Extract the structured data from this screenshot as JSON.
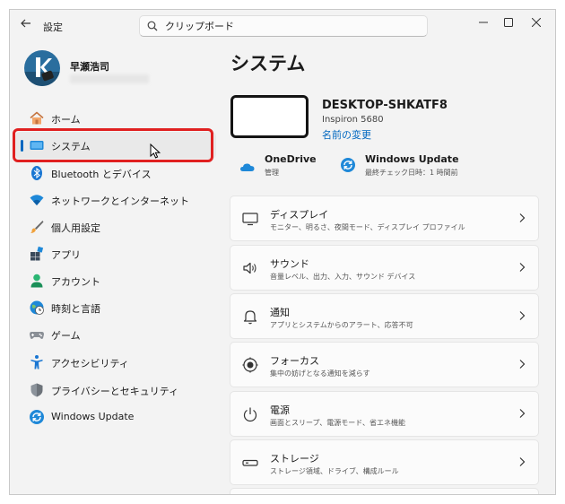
{
  "window": {
    "app_title": "設定",
    "search_value": "クリップボード"
  },
  "profile": {
    "name": "早瀬浩司"
  },
  "sidebar": {
    "items": [
      {
        "label": "ホーム",
        "icon": "home-icon"
      },
      {
        "label": "システム",
        "icon": "system-icon",
        "selected": true
      },
      {
        "label": "Bluetooth とデバイス",
        "icon": "bluetooth-icon"
      },
      {
        "label": "ネットワークとインターネット",
        "icon": "network-icon"
      },
      {
        "label": "個人用設定",
        "icon": "brush-icon"
      },
      {
        "label": "アプリ",
        "icon": "apps-icon"
      },
      {
        "label": "アカウント",
        "icon": "account-icon"
      },
      {
        "label": "時刻と言語",
        "icon": "time-language-icon"
      },
      {
        "label": "ゲーム",
        "icon": "gaming-icon"
      },
      {
        "label": "アクセシビリティ",
        "icon": "accessibility-icon"
      },
      {
        "label": "プライバシーとセキュリティ",
        "icon": "shield-icon"
      },
      {
        "label": "Windows Update",
        "icon": "windows-update-icon"
      }
    ]
  },
  "main": {
    "title": "システム",
    "device": {
      "name": "DESKTOP-SHKATF8",
      "model": "Inspiron 5680",
      "rename_link": "名前の変更"
    },
    "quick": [
      {
        "title": "OneDrive",
        "subtitle": "管理",
        "icon": "onedrive-icon"
      },
      {
        "title": "Windows Update",
        "subtitle": "最終チェック日時：1 時間前",
        "icon": "windows-update-icon"
      }
    ],
    "cards": [
      {
        "title": "ディスプレイ",
        "subtitle": "モニター、明るさ、夜間モード、ディスプレイ プロファイル",
        "icon": "display-icon"
      },
      {
        "title": "サウンド",
        "subtitle": "音量レベル、出力、入力、サウンド デバイス",
        "icon": "sound-icon"
      },
      {
        "title": "通知",
        "subtitle": "アプリとシステムからのアラート、応答不可",
        "icon": "notification-icon"
      },
      {
        "title": "フォーカス",
        "subtitle": "集中の妨げとなる通知を減らす",
        "icon": "focus-icon"
      },
      {
        "title": "電源",
        "subtitle": "画面とスリープ、電源モード、省エネ機能",
        "icon": "power-icon"
      },
      {
        "title": "ストレージ",
        "subtitle": "ストレージ領域、ドライブ、構成ルール",
        "icon": "storage-icon"
      }
    ]
  },
  "colors": {
    "accent": "#0067c0",
    "highlight_box": "#e02020"
  }
}
